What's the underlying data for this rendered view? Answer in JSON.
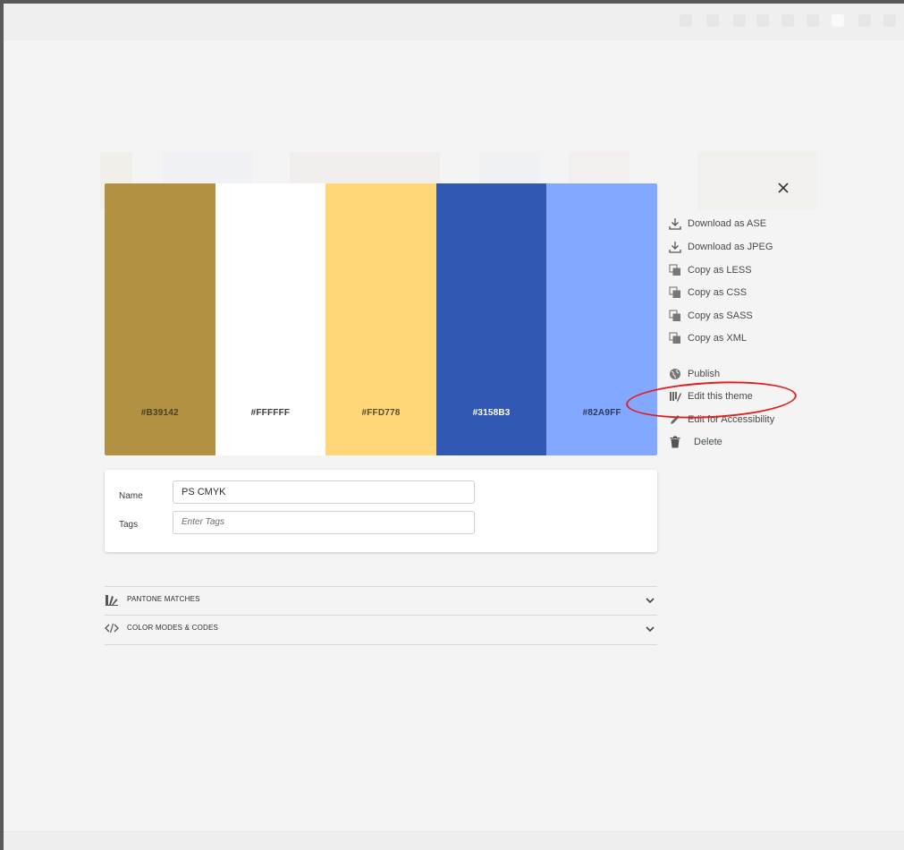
{
  "colors": {
    "annotation": "#e02020"
  },
  "palette": [
    {
      "hex_label": "#B39142",
      "fill": "#B39142",
      "text_color": "#4a3f20"
    },
    {
      "hex_label": "#FFFFFF",
      "fill": "#FFFFFF",
      "text_color": "#3c3c3c"
    },
    {
      "hex_label": "#FFD778",
      "fill": "#FFD778",
      "text_color": "#5a4c2a"
    },
    {
      "hex_label": "#3158B3",
      "fill": "#3158B3",
      "text_color": "#ffffff"
    },
    {
      "hex_label": "#82A9FF",
      "fill": "#82A9FF",
      "text_color": "#2d3a5c"
    }
  ],
  "details": {
    "name_label": "Name",
    "name_value": "PS CMYK",
    "tags_label": "Tags",
    "tags_placeholder": "Enter Tags"
  },
  "sections": {
    "pantone": {
      "label": "PANTONE MATCHES",
      "icon": "pantone-fan-icon"
    },
    "color_modes": {
      "label": "COLOR MODES & CODES",
      "icon": "code-brackets-icon"
    }
  },
  "actions": {
    "close_icon": "close-icon",
    "download_ase": "Download as ASE",
    "download_jpeg": "Download as JPEG",
    "copy_less": "Copy as LESS",
    "copy_css": "Copy as CSS",
    "copy_sass": "Copy as SASS",
    "copy_xml": "Copy as XML",
    "publish": "Publish",
    "edit_theme": "Edit this theme",
    "edit_accessibility": "Edit for Accessibility",
    "delete": "Delete"
  }
}
